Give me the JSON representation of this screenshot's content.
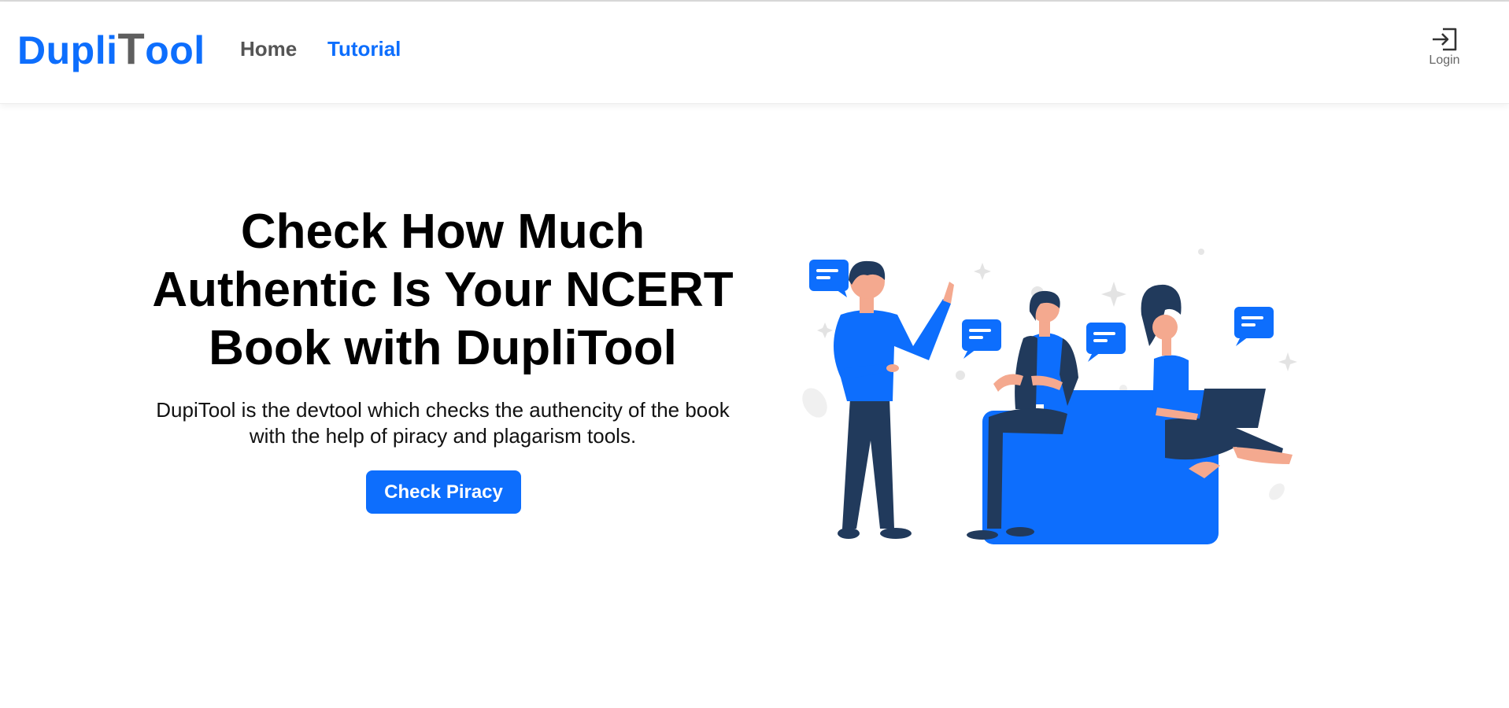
{
  "brand": {
    "part1": "Dupli",
    "part2": "T",
    "part3": "ool"
  },
  "nav": {
    "home": "Home",
    "tutorial": "Tutorial",
    "login": "Login"
  },
  "hero": {
    "title": "Check How Much Authentic Is Your NCERT Book with DupliTool",
    "subtitle": "DupiTool is the devtool which checks the authencity of the book with the help of piracy and plagarism tools.",
    "cta": "Check Piracy"
  },
  "icons": {
    "login": "login-arrow-icon"
  },
  "colors": {
    "primary": "#0d6efd",
    "dark_figure": "#213a5c",
    "skin": "#f4a98f"
  }
}
